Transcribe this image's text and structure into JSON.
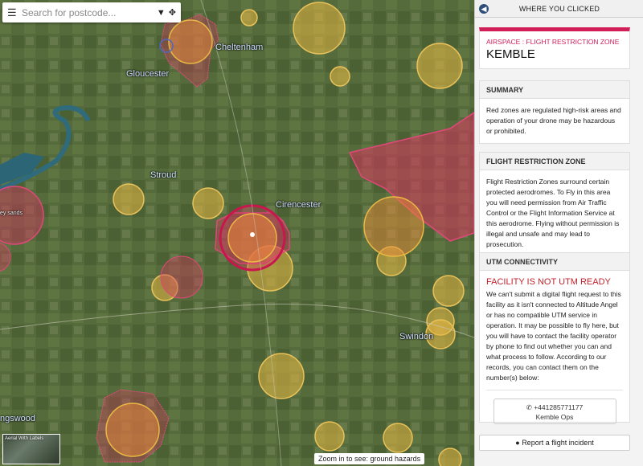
{
  "search": {
    "placeholder": "Search for postcode..."
  },
  "map": {
    "labels": {
      "gloucester": "Gloucester",
      "stroud": "Stroud",
      "cirencester": "Cirencester",
      "swindon": "Swindon",
      "cheltenham": "Cheltenham",
      "kingswood": "ngswood",
      "hey_sands": "ey sands"
    },
    "layer_label": "Aerial With Labels",
    "zoom_hint": "Zoom in to see: ground hazards",
    "colors": {
      "restriction_zone": "#d8345f",
      "caution_zone": "#e9b843",
      "airspace_orange": "#e98c3a"
    }
  },
  "panel": {
    "title": "WHERE YOU CLICKED",
    "airspace": {
      "type_label": "AIRSPACE : FLIGHT RESTRICTION ZONE",
      "name": "KEMBLE"
    },
    "summary": {
      "heading": "SUMMARY",
      "text": "Red zones are regulated high-risk areas and operation of your drone may be hazardous or prohibited."
    },
    "frz": {
      "heading": "FLIGHT RESTRICTION ZONE",
      "text": "Flight Restriction Zones surround certain protected aerodromes. To Fly in this area you will need permission from Air Traffic Control or the Flight Information Service at this aerodrome. Flying without permission is illegal and unsafe and may lead to prosecution."
    },
    "utm": {
      "heading": "UTM CONNECTIVITY",
      "status": "FACILITY IS NOT UTM READY",
      "text": "We can't submit a digital flight request to this facility as it isn't connected to Altitude Angel or has no compatible UTM service in operation. It may be possible to fly here, but you will have to contact the facility operator by phone to find out whether you can and what process to follow. According to our records, you can contact them on the number(s) below:",
      "phone": "+441285771177",
      "contact_name": "Kemble Ops"
    },
    "report_label": "Report a flight incident"
  }
}
